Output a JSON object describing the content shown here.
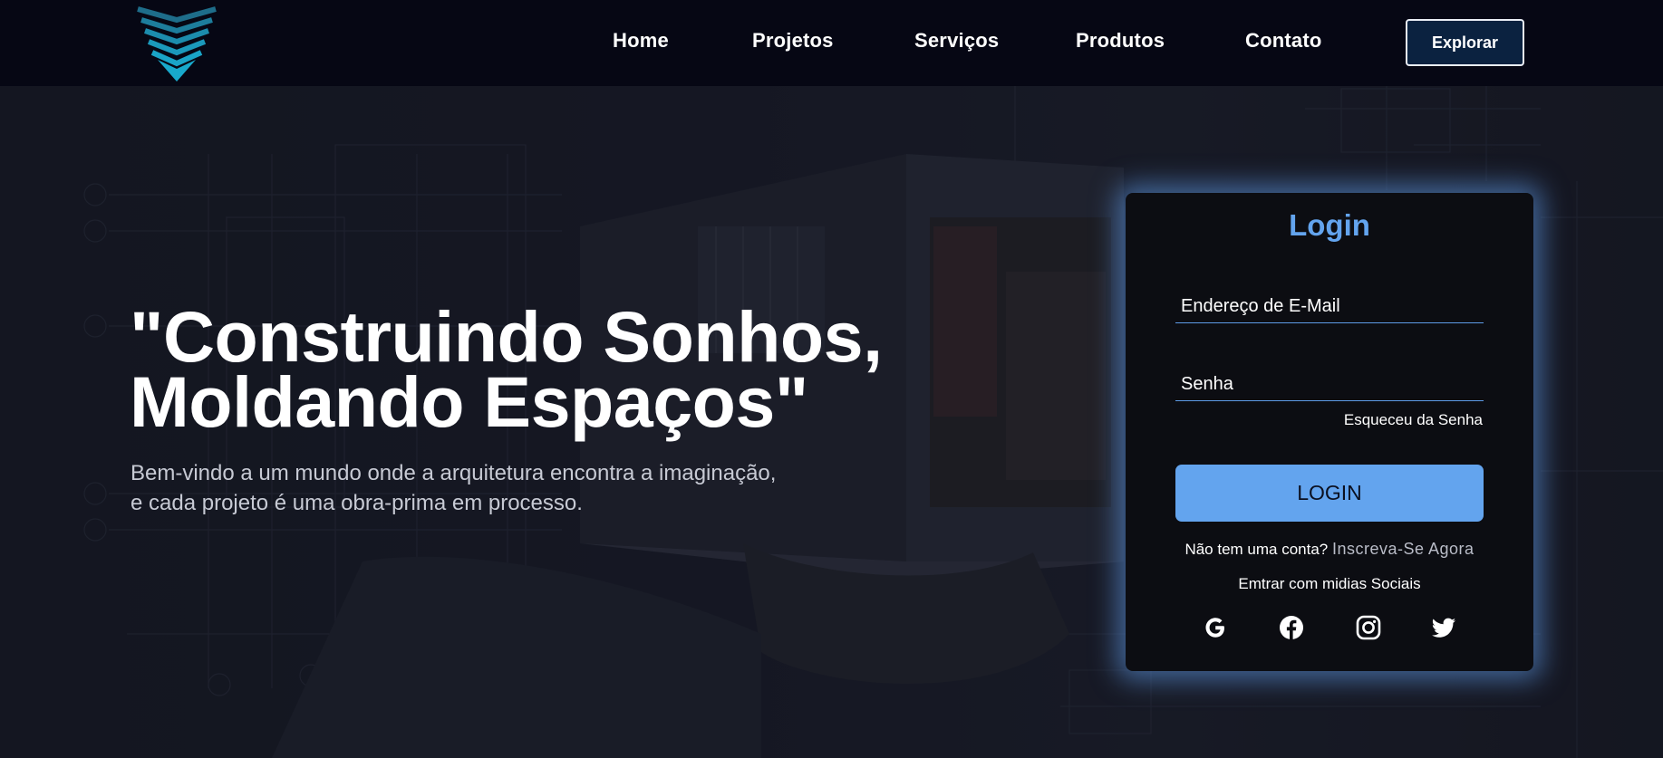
{
  "nav": {
    "items": [
      "Home",
      "Projetos",
      "Serviços",
      "Produtos",
      "Contato"
    ],
    "cta_label": "Explorar"
  },
  "hero": {
    "title": "\"Construindo Sonhos,\nMoldando Espaços\"",
    "subtitle_lines": [
      "Bem-vindo a um mundo onde a arquitetura encontra a imaginação,",
      "e cada projeto é uma obra-prima em processo."
    ]
  },
  "login": {
    "title": "Login",
    "email_placeholder": "Endereço de E-Mail",
    "password_placeholder": "Senha",
    "forgot_label": "Esqueceu da Senha",
    "submit_label": "LOGIN",
    "no_account_text": "Não tem uma conta?",
    "signup_link": "Inscreva-Se Agora",
    "social_text": "Emtrar com midias Sociais",
    "socials": [
      "google-icon",
      "facebook-icon",
      "instagram-icon",
      "twitter-icon"
    ]
  },
  "colors": {
    "nav_bg": "#060714",
    "accent": "#63a4ee",
    "cta_bg": "#0b2240",
    "card_bg": "#0c0d12"
  }
}
